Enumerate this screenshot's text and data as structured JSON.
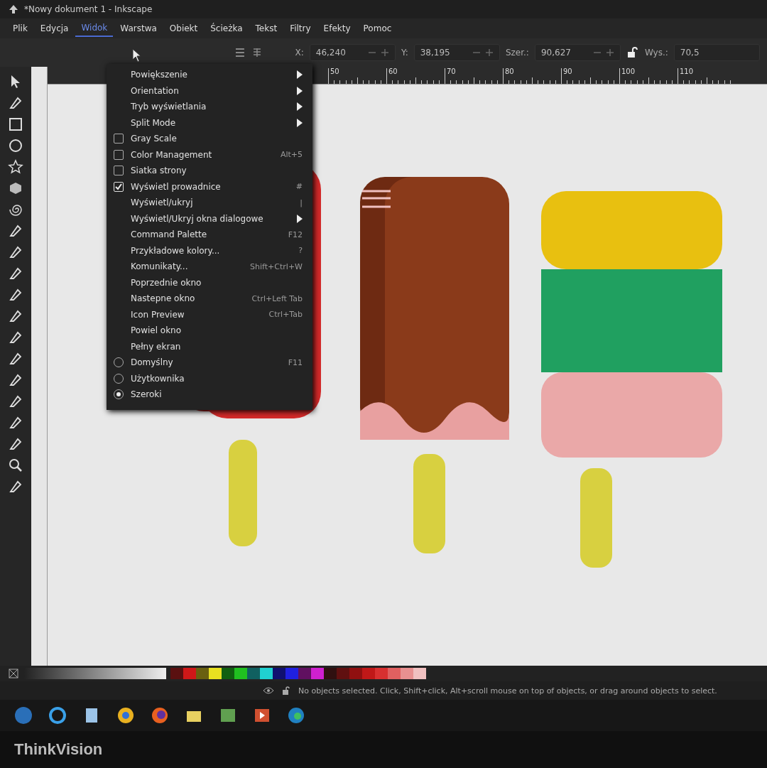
{
  "window": {
    "title": "*Nowy dokument 1 - Inkscape"
  },
  "menubar": [
    {
      "label": "Plik",
      "selected": false
    },
    {
      "label": "Edycja",
      "selected": false
    },
    {
      "label": "Widok",
      "selected": true
    },
    {
      "label": "Warstwa",
      "selected": false
    },
    {
      "label": "Obiekt",
      "selected": false
    },
    {
      "label": "Ścieżka",
      "selected": false
    },
    {
      "label": "Tekst",
      "selected": false
    },
    {
      "label": "Filtry",
      "selected": false
    },
    {
      "label": "Efekty",
      "selected": false
    },
    {
      "label": "Pomoc",
      "selected": false
    }
  ],
  "menu": {
    "items": [
      {
        "kind": "submenu",
        "label": "Powiększenie"
      },
      {
        "kind": "submenu",
        "label": "Orientation"
      },
      {
        "kind": "submenu",
        "label": "Tryb wyświetlania"
      },
      {
        "kind": "submenu",
        "label": "Split Mode"
      },
      {
        "kind": "check",
        "label": "Gray Scale",
        "checked": false
      },
      {
        "kind": "check",
        "label": "Color Management",
        "checked": false,
        "shortcut": "Alt+5"
      },
      {
        "kind": "check",
        "label": "Siatka strony",
        "checked": false
      },
      {
        "kind": "check",
        "label": "Wyświetl prowadnice",
        "checked": true,
        "shortcut": "#"
      },
      {
        "kind": "plain",
        "label": "Wyświetl/ukryj",
        "shortcut": "|"
      },
      {
        "kind": "submenu",
        "label": "Wyświetl/Ukryj okna dialogowe"
      },
      {
        "kind": "plain",
        "label": "Command Palette",
        "shortcut": "F12"
      },
      {
        "kind": "plain",
        "label": "Przykładowe kolory...",
        "shortcut": "?"
      },
      {
        "kind": "plain",
        "label": "Komunikaty...",
        "shortcut": "Shift+Ctrl+W"
      },
      {
        "kind": "plain",
        "label": "Poprzednie okno"
      },
      {
        "kind": "plain",
        "label": "Nastepne okno",
        "shortcut": "Ctrl+Left Tab"
      },
      {
        "kind": "plain",
        "label": "Icon Preview",
        "shortcut": "Ctrl+Tab"
      },
      {
        "kind": "plain",
        "label": "Powiel okno"
      },
      {
        "kind": "plain",
        "label": "Pełny ekran"
      },
      {
        "kind": "radio",
        "label": "Domyślny",
        "selected": false,
        "shortcut": "F11"
      },
      {
        "kind": "radio",
        "label": "Użytkownika",
        "selected": false
      },
      {
        "kind": "radio",
        "label": "Szeroki",
        "selected": true
      }
    ]
  },
  "toolbar": {
    "fields": [
      {
        "label": "X:",
        "value": "46,240"
      },
      {
        "label": "Y:",
        "value": "38,195"
      },
      {
        "label": "Szer.:",
        "value": "90,627"
      },
      {
        "label": "Wys.:",
        "value": "70,5"
      }
    ]
  },
  "ruler": {
    "labels": [
      "50",
      "60",
      "70",
      "80",
      "90",
      "100",
      "110"
    ]
  },
  "palette": [
    {
      "color": "#5a1010"
    },
    {
      "color": "#d01818"
    },
    {
      "color": "#6a6010"
    },
    {
      "color": "#e8e020"
    },
    {
      "color": "#106010"
    },
    {
      "color": "#20c020"
    },
    {
      "color": "#106060"
    },
    {
      "color": "#20d0d0"
    },
    {
      "color": "#101070"
    },
    {
      "color": "#2020e0"
    },
    {
      "color": "#601060"
    },
    {
      "color": "#d020d0"
    },
    {
      "color": "#301010"
    },
    {
      "color": "#601010"
    },
    {
      "color": "#901010"
    },
    {
      "color": "#c01818"
    },
    {
      "color": "#d83030"
    },
    {
      "color": "#e06060"
    },
    {
      "color": "#e89090"
    },
    {
      "color": "#f0c0c0"
    }
  ],
  "status_bar": {
    "message": "No objects selected. Click, Shift+click, Alt+scroll mouse on top of objects, or drag around objects to select."
  },
  "bezel": {
    "brand": "ThinkVision"
  }
}
